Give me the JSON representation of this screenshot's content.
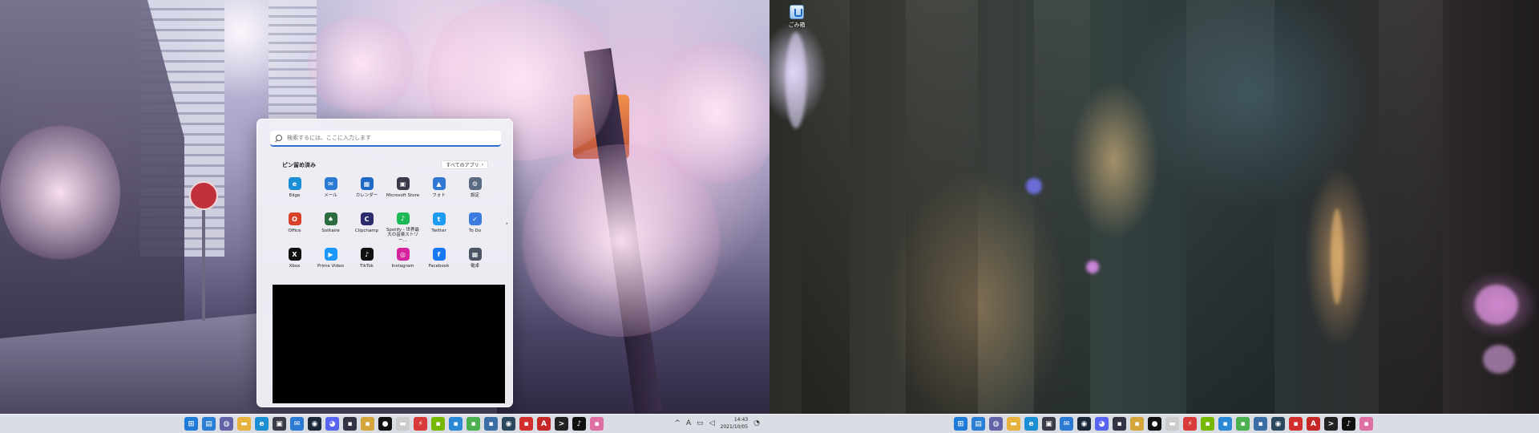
{
  "desktop": {
    "recycle_bin": {
      "label": "ごみ箱",
      "icon": "recycle-bin-icon"
    }
  },
  "start_menu": {
    "search_placeholder": "検索するには、ここに入力します",
    "pinned_heading": "ピン留め済み",
    "all_apps_label": "すべてのアプリ",
    "all_apps_chevron": "›",
    "pinned_apps": [
      {
        "name": "Edge",
        "icon": "edge-icon",
        "color": "#1a8fd6",
        "glyph": "e"
      },
      {
        "name": "メール",
        "icon": "mail-icon",
        "color": "#2b7bd4",
        "glyph": "✉"
      },
      {
        "name": "カレンダー",
        "icon": "calendar-icon",
        "color": "#1f6ac5",
        "glyph": "▦"
      },
      {
        "name": "Microsoft Store",
        "icon": "store-icon",
        "color": "#3a3a48",
        "glyph": "▣"
      },
      {
        "name": "フォト",
        "icon": "photos-icon",
        "color": "#2f77d0",
        "glyph": "▲"
      },
      {
        "name": "設定",
        "icon": "settings-icon",
        "color": "#5a6a80",
        "glyph": "⚙"
      },
      {
        "name": "Office",
        "icon": "office-icon",
        "color": "#d9412b",
        "glyph": "O"
      },
      {
        "name": "Solitaire",
        "icon": "solitaire-icon",
        "color": "#2a6b3f",
        "glyph": "♠"
      },
      {
        "name": "Clipchamp",
        "icon": "clipchamp-icon",
        "color": "#2c2c6c",
        "glyph": "C"
      },
      {
        "name": "Spotify - 世界最大の音楽ストリー...",
        "icon": "spotify-icon",
        "color": "#1db954",
        "glyph": "♪"
      },
      {
        "name": "Twitter",
        "icon": "twitter-icon",
        "color": "#1d9bf0",
        "glyph": "t"
      },
      {
        "name": "To Do",
        "icon": "todo-icon",
        "color": "#3d7be0",
        "glyph": "✓"
      },
      {
        "name": "Xbox",
        "icon": "xbox-icon",
        "color": "#111111",
        "glyph": "X"
      },
      {
        "name": "Prime Video",
        "icon": "prime-video-icon",
        "color": "#1a98ff",
        "glyph": "▶"
      },
      {
        "name": "TikTok",
        "icon": "tiktok-icon",
        "color": "#111111",
        "glyph": "♪"
      },
      {
        "name": "Instagram",
        "icon": "instagram-icon",
        "color": "#d6249f",
        "glyph": "◎"
      },
      {
        "name": "Facebook",
        "icon": "facebook-icon",
        "color": "#1877f2",
        "glyph": "f"
      },
      {
        "name": "電卓",
        "icon": "calculator-icon",
        "color": "#4b5566",
        "glyph": "▦"
      }
    ]
  },
  "taskbar": {
    "apps": [
      {
        "icon": "start-icon",
        "color": "#1e7bd8",
        "glyph": "⊞"
      },
      {
        "icon": "widgets-icon",
        "color": "#2a7fd4",
        "glyph": "▤"
      },
      {
        "icon": "chat-icon",
        "color": "#6264a7",
        "glyph": "◍"
      },
      {
        "icon": "file-explorer-icon",
        "color": "#e8b33c",
        "glyph": "▬"
      },
      {
        "icon": "edge-icon",
        "color": "#1a8fd6",
        "glyph": "e"
      },
      {
        "icon": "store-icon",
        "color": "#3a3a48",
        "glyph": "▣"
      },
      {
        "icon": "mail-icon",
        "color": "#2b7bd4",
        "glyph": "✉"
      },
      {
        "icon": "steam-icon",
        "color": "#1b2838",
        "glyph": "◉"
      },
      {
        "icon": "discord-icon",
        "color": "#5865f2",
        "glyph": "◕"
      },
      {
        "icon": "app-icon-1",
        "color": "#333344",
        "glyph": "▪"
      },
      {
        "icon": "app-icon-2",
        "color": "#d4a53a",
        "glyph": "▪"
      },
      {
        "icon": "app-icon-3",
        "color": "#111111",
        "glyph": "●"
      },
      {
        "icon": "app-icon-4",
        "color": "#cccccc",
        "glyph": "▬"
      },
      {
        "icon": "app-icon-5",
        "color": "#d93b3b",
        "glyph": "⚡"
      },
      {
        "icon": "nvidia-icon",
        "color": "#76b900",
        "glyph": "▪"
      },
      {
        "icon": "app-icon-6",
        "color": "#2b8ad8",
        "glyph": "▪"
      },
      {
        "icon": "app-icon-7",
        "color": "#4caf50",
        "glyph": "▪"
      },
      {
        "icon": "app-icon-8",
        "color": "#3a6ea5",
        "glyph": "▪"
      },
      {
        "icon": "steam-icon-2",
        "color": "#2a475e",
        "glyph": "◉"
      },
      {
        "icon": "app-icon-9",
        "color": "#d32f2f",
        "glyph": "▪"
      },
      {
        "icon": "acrobat-icon",
        "color": "#c62828",
        "glyph": "A"
      },
      {
        "icon": "terminal-icon",
        "color": "#222222",
        "glyph": ">"
      },
      {
        "icon": "tiktok-icon",
        "color": "#111111",
        "glyph": "♪"
      },
      {
        "icon": "app-icon-10",
        "color": "#e06fa3",
        "glyph": "▪"
      }
    ],
    "tray": {
      "chevron": "^",
      "ime": "A",
      "time": "14:43",
      "date": "2021/10/05"
    }
  }
}
